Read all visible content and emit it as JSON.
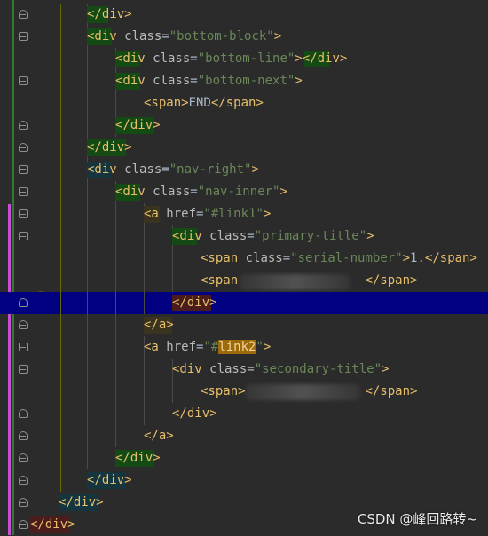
{
  "editor": {
    "lines": [
      {
        "parts": [
          {
            "t": "</div>",
            "k": "tag"
          }
        ]
      },
      {
        "parts": [
          {
            "t": "<div",
            "k": "tag"
          },
          {
            "t": " class",
            "k": "attr"
          },
          {
            "t": "=",
            "k": "text"
          },
          {
            "t": "\"bottom-block\"",
            "k": "val"
          },
          {
            "t": ">",
            "k": "tag"
          }
        ]
      },
      {
        "parts": [
          {
            "t": "<div",
            "k": "tag"
          },
          {
            "t": " class",
            "k": "attr"
          },
          {
            "t": "=",
            "k": "text"
          },
          {
            "t": "\"bottom-line\"",
            "k": "val"
          },
          {
            "t": "></div>",
            "k": "tag"
          }
        ]
      },
      {
        "parts": [
          {
            "t": "<div",
            "k": "tag"
          },
          {
            "t": " class",
            "k": "attr"
          },
          {
            "t": "=",
            "k": "text"
          },
          {
            "t": "\"bottom-next\"",
            "k": "val"
          },
          {
            "t": ">",
            "k": "tag"
          }
        ]
      },
      {
        "parts": [
          {
            "t": "<span>",
            "k": "tag"
          },
          {
            "t": "END",
            "k": "text"
          },
          {
            "t": "</span>",
            "k": "tag"
          }
        ]
      },
      {
        "parts": [
          {
            "t": "</div>",
            "k": "tag"
          }
        ]
      },
      {
        "parts": [
          {
            "t": "</div>",
            "k": "tag"
          }
        ]
      },
      {
        "parts": [
          {
            "t": "<div",
            "k": "tag"
          },
          {
            "t": " class",
            "k": "attr"
          },
          {
            "t": "=",
            "k": "text"
          },
          {
            "t": "\"nav-right\"",
            "k": "val"
          },
          {
            "t": ">",
            "k": "tag"
          }
        ]
      },
      {
        "parts": [
          {
            "t": "<div",
            "k": "tag"
          },
          {
            "t": " class",
            "k": "attr"
          },
          {
            "t": "=",
            "k": "text"
          },
          {
            "t": "\"nav-inner\"",
            "k": "val"
          },
          {
            "t": ">",
            "k": "tag"
          }
        ]
      },
      {
        "parts": [
          {
            "t": "<a",
            "k": "tag"
          },
          {
            "t": " href",
            "k": "attr"
          },
          {
            "t": "=",
            "k": "text"
          },
          {
            "t": "\"#link1\"",
            "k": "val"
          },
          {
            "t": ">",
            "k": "tag"
          }
        ]
      },
      {
        "parts": [
          {
            "t": "<div",
            "k": "tag"
          },
          {
            "t": " class",
            "k": "attr"
          },
          {
            "t": "=",
            "k": "text"
          },
          {
            "t": "\"primary-title\"",
            "k": "val"
          },
          {
            "t": ">",
            "k": "tag"
          }
        ]
      },
      {
        "parts": [
          {
            "t": "<span",
            "k": "tag"
          },
          {
            "t": " class",
            "k": "attr"
          },
          {
            "t": "=",
            "k": "text"
          },
          {
            "t": "\"serial-number\"",
            "k": "val"
          },
          {
            "t": ">",
            "k": "tag"
          },
          {
            "t": "1.",
            "k": "text"
          },
          {
            "t": "</span>",
            "k": "tag"
          }
        ]
      },
      {
        "parts": [
          {
            "t": "<span",
            "k": "tag"
          },
          {
            "t": "                 ",
            "k": "text"
          },
          {
            "t": "</span>",
            "k": "tag"
          }
        ]
      },
      {
        "parts": [
          {
            "t": "</div>",
            "k": "tag"
          }
        ]
      },
      {
        "parts": [
          {
            "t": "</a>",
            "k": "tag"
          }
        ]
      },
      {
        "parts": [
          {
            "t": "<a",
            "k": "tag"
          },
          {
            "t": " href",
            "k": "attr"
          },
          {
            "t": "=",
            "k": "text"
          },
          {
            "t": "\"#",
            "k": "val"
          },
          {
            "t": "link2",
            "k": "link"
          },
          {
            "t": "\"",
            "k": "val"
          },
          {
            "t": ">",
            "k": "tag"
          }
        ]
      },
      {
        "parts": [
          {
            "t": "<div",
            "k": "tag"
          },
          {
            "t": " class",
            "k": "attr"
          },
          {
            "t": "=",
            "k": "text"
          },
          {
            "t": "\"secondary-title\"",
            "k": "val"
          },
          {
            "t": ">",
            "k": "tag"
          }
        ]
      },
      {
        "parts": [
          {
            "t": "<span>",
            "k": "tag"
          },
          {
            "t": "                ",
            "k": "text"
          },
          {
            "t": "</span>",
            "k": "tag"
          }
        ]
      },
      {
        "parts": [
          {
            "t": "</div>",
            "k": "tag"
          }
        ]
      },
      {
        "parts": [
          {
            "t": "</a>",
            "k": "tag"
          }
        ]
      },
      {
        "parts": [
          {
            "t": "</div>",
            "k": "tag"
          }
        ]
      },
      {
        "parts": [
          {
            "t": "</div>",
            "k": "tag"
          }
        ]
      },
      {
        "parts": [
          {
            "t": "</div>",
            "k": "tag"
          }
        ]
      },
      {
        "parts": [
          {
            "t": "</div>",
            "k": "tag"
          }
        ]
      }
    ]
  },
  "watermark": "CSDN @峰回路转~",
  "icons": [
    "fold-marker-icon",
    "lightbulb-icon"
  ],
  "colors": {
    "background": "#2b2b2b",
    "tag": "#e8bf6a",
    "attribute": "#bababa",
    "value": "#6a8759",
    "text": "#a9b7c6",
    "current_line": "#000080",
    "search_highlight": "#9c6a08"
  }
}
